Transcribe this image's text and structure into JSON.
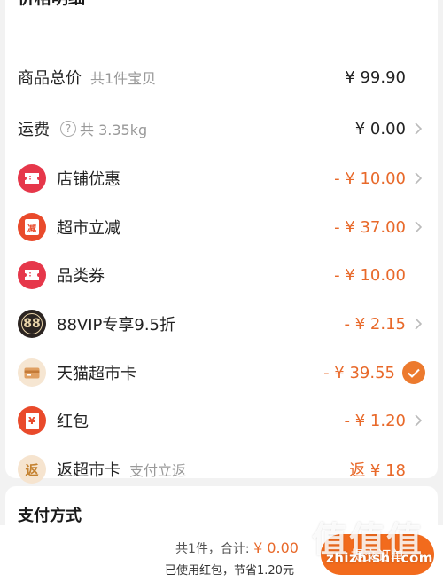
{
  "price_detail": {
    "title": "价格明细",
    "rows": [
      {
        "label": "商品总价",
        "sub": "共1件宝贝",
        "amount": "¥ 99.90",
        "style": "plain",
        "chevron": false
      },
      {
        "label": "运费",
        "sub": "共 3.35kg",
        "amount": "¥ 0.00",
        "style": "plain",
        "chevron": true
      },
      {
        "label": "店铺优惠",
        "amount": "- ¥ 10.00",
        "icon": "ticket-icon",
        "icon_bg": "#e6374a",
        "style": "discount",
        "chevron": true
      },
      {
        "label": "超市立减",
        "amount": "- ¥ 37.00",
        "icon": "minus-badge-icon",
        "icon_bg": "#e94a2b",
        "icon_glyph": "减",
        "style": "discount",
        "chevron": true
      },
      {
        "label": "品类券",
        "amount": "- ¥ 10.00",
        "icon": "ticket-icon",
        "icon_bg": "#e6374a",
        "style": "discount",
        "chevron": false
      },
      {
        "label": "88VIP专享9.5折",
        "amount": "- ¥ 2.15",
        "icon": "vip-88-icon",
        "icon_bg": "#2b2421",
        "icon_glyph": "88",
        "style": "discount",
        "chevron": true
      },
      {
        "label": "天猫超市卡",
        "amount": "- ¥ 39.55",
        "icon": "card-icon",
        "icon_bg": "#f6e6d2",
        "style": "discount",
        "checked": true
      },
      {
        "label": "红包",
        "amount": "- ¥ 1.20",
        "icon": "red-envelope-icon",
        "icon_bg": "#e94a2b",
        "icon_glyph": "¥",
        "style": "discount",
        "chevron": true
      },
      {
        "label": "返超市卡",
        "sub": "支付立返",
        "amount": "返 ¥ 18",
        "icon": "rebate-icon",
        "icon_bg": "#f6e4cf",
        "icon_glyph": "返",
        "style": "rebate",
        "chevron": false
      }
    ]
  },
  "payment": {
    "title": "支付方式"
  },
  "bottom_bar": {
    "count_text": "共1件，合计:",
    "total": "¥ 0.00",
    "saved_text": "已使用红包，节省1.20元",
    "submit_label": "提交订单"
  },
  "watermark": {
    "glyphs": "值值值",
    "text": "zhizhishi.com"
  },
  "colors": {
    "accent": "#e8692a",
    "page_bg": "#f2f2f2"
  }
}
